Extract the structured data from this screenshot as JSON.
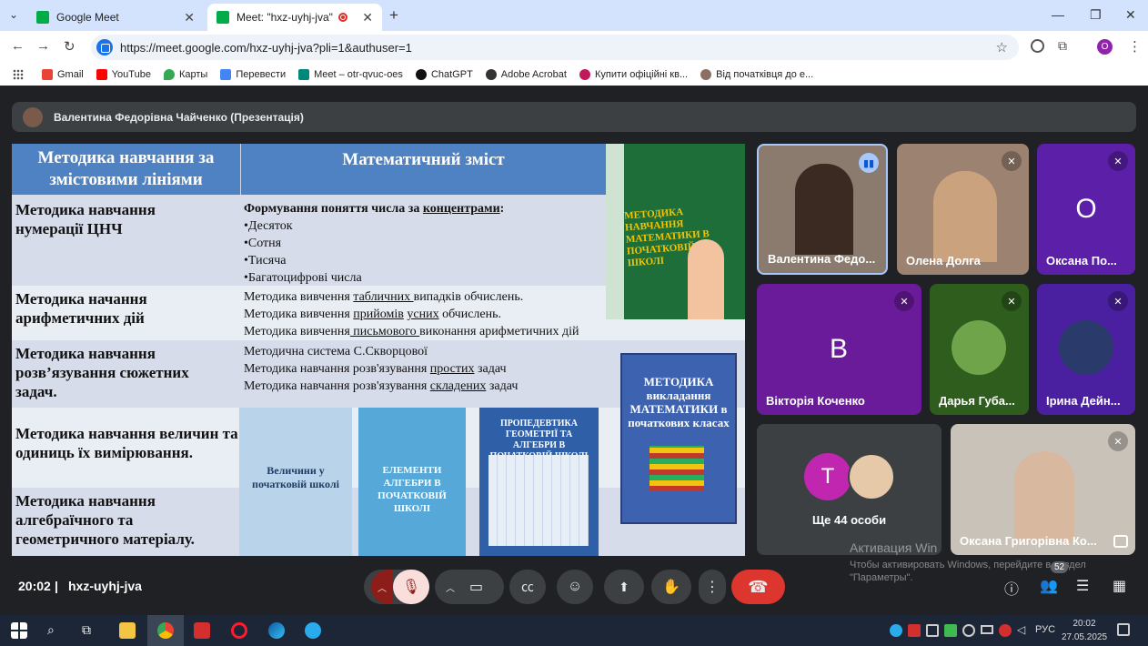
{
  "tabs": [
    {
      "title": "Google Meet",
      "close": "✕"
    },
    {
      "title": "Meet: \"hxz-uyhj-jva\"",
      "close": "✕"
    }
  ],
  "new_tab": "+",
  "url": "https://meet.google.com/hxz-uyhj-jva?pli=1&authuser=1",
  "profile_initial": "O",
  "bookmarks": [
    {
      "label": "Gmail",
      "color": "#ea4335"
    },
    {
      "label": "YouTube",
      "color": "#ff0000"
    },
    {
      "label": "Карты",
      "color": "#34a853"
    },
    {
      "label": "Перевести",
      "color": "#4285f4"
    },
    {
      "label": "Meet – otr-qvuc-oes",
      "color": "#00897b"
    },
    {
      "label": "ChatGPT",
      "color": "#111111"
    },
    {
      "label": "Adobe Acrobat",
      "color": "#333333"
    },
    {
      "label": "Купити офіційні кв...",
      "color": "#c2185b"
    },
    {
      "label": "Від початківця до е...",
      "color": "#8d6e63"
    }
  ],
  "presenter": "Валентина Федорівна Чайченко (Презентація)",
  "slide": {
    "header_left": "Методика навчання за змістовими лініями",
    "header_right": "Математичний зміст",
    "rows": [
      {
        "left": "Методика навчання нумерації ЦНЧ",
        "lines": [
          "Формування поняття числа за концентрами:",
          "•Десяток",
          "•Сотня",
          "•Тисяча",
          "•Багатоцифрові числа"
        ]
      },
      {
        "left": "Методика начання арифметичних дій",
        "lines": [
          "Методика вивчення табличних випадків обчислень.",
          "Методика вивчення прийомів усних обчислень.",
          "Методика вивчення письмового виконання арифметичних дій"
        ]
      },
      {
        "left": "Методика навчання розв’язування сюжетних задач.",
        "lines": [
          "Методична система С.Скворцової",
          "Методика навчання розв'язування простих задач",
          "Методика навчання розв'язування складених задач"
        ]
      },
      {
        "left": "Методика навчання величин та одиниць їх вимірювання.",
        "lines": []
      },
      {
        "left": "Методика навчання алгебраїчного та геометричного матеріалу.",
        "lines": []
      }
    ],
    "books": [
      {
        "title": "МЕТОДИКА НАВЧАННЯ МАТЕМАТИКИ В ПОЧАТКОВІЙ ШКОЛІ"
      },
      {
        "title": "МЕТОДИКА викладання МАТЕМАТИКИ в початкових класах"
      },
      {
        "title": "Величини у початковій школі"
      },
      {
        "title": "ЕЛЕМЕНТИ АЛГЕБРИ В ПОЧАТКОВІЙ ШКОЛІ"
      },
      {
        "title": "ПРОПЕДЕВТИКА ГЕОМЕТРІЇ ТА АЛГЕБРИ В ПОЧАТКОВІЙ ШКОЛІ"
      }
    ]
  },
  "participants": [
    {
      "name": "Валентина Федо...",
      "kind": "video",
      "speaking": true
    },
    {
      "name": "Олена Долга",
      "kind": "video",
      "muted": true
    },
    {
      "name": "Оксана По...",
      "kind": "letter",
      "letter": "O",
      "bg": "#5b1fa8",
      "muted": true
    },
    {
      "name": "Вікторія Коченко",
      "kind": "letter",
      "letter": "В",
      "bg": "#6a1b9a",
      "muted": true
    },
    {
      "name": "Дарья Губа...",
      "kind": "photo",
      "bg": "#2e5d1e",
      "muted": true
    },
    {
      "name": "Ірина Дейн...",
      "kind": "photo",
      "bg": "#4a1fa0",
      "muted": true
    },
    {
      "name": "Оксана Григорівна Ко...",
      "kind": "video",
      "muted": true
    }
  ],
  "others": {
    "label": "Ще 44 особи",
    "letter": "T"
  },
  "meeting": {
    "time": "20:02",
    "code": "hxz-uyhj-jva"
  },
  "people_count": "52",
  "watermark": {
    "title": "Активация Win",
    "text": "Чтобы активировать Windows, перейдите в раздел \"Параметры\"."
  },
  "taskbar": {
    "lang": "РУС",
    "time": "20:02",
    "date": "27.05.2025"
  }
}
